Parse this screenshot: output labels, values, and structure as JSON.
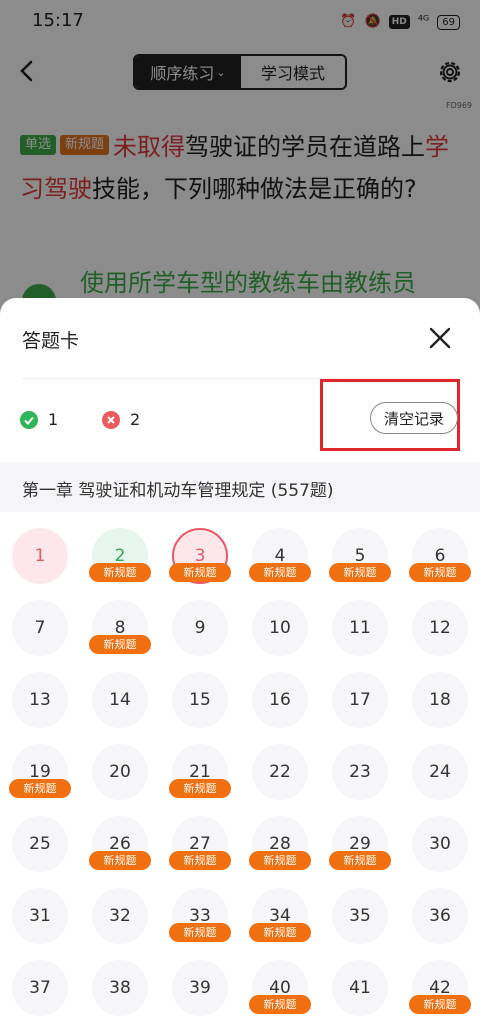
{
  "status_bar": {
    "time": "15:17",
    "net": "⁴ᴳ",
    "hd": "HD",
    "battery": "69"
  },
  "nav": {
    "mode_order": "顺序练习",
    "mode_study": "学习模式"
  },
  "code": "FD969",
  "question": {
    "tag_single": "单选",
    "tag_new": "新规题",
    "parts": [
      {
        "text": "未取得",
        "red": true
      },
      {
        "text": "驾驶证的学员在道路上",
        "red": false
      },
      {
        "text": "学习驾驶",
        "red": true
      },
      {
        "text": "技能，下列哪种做法是正确的?",
        "red": false
      }
    ],
    "option_a": "使用所学车型的教练车由教练员"
  },
  "sheet": {
    "title": "答题卡",
    "correct_count": "1",
    "wrong_count": "2",
    "clear_label": "清空记录",
    "chapter": "第一章  驾驶证和机动车管理规定 (557题)"
  },
  "badge_label": "新规题",
  "colors": {
    "accent_orange": "#f06f10",
    "correct_green": "#2fb55a",
    "wrong_red": "#ee5a5a",
    "highlight": "#e0262c"
  },
  "cells": [
    {
      "n": "1",
      "state": "wrong",
      "new": false
    },
    {
      "n": "2",
      "state": "right",
      "new": true
    },
    {
      "n": "3",
      "state": "current",
      "new": true
    },
    {
      "n": "4",
      "state": "none",
      "new": true
    },
    {
      "n": "5",
      "state": "none",
      "new": true
    },
    {
      "n": "6",
      "state": "none",
      "new": true
    },
    {
      "n": "7",
      "state": "none",
      "new": false
    },
    {
      "n": "8",
      "state": "none",
      "new": true
    },
    {
      "n": "9",
      "state": "none",
      "new": false
    },
    {
      "n": "10",
      "state": "none",
      "new": false
    },
    {
      "n": "11",
      "state": "none",
      "new": false
    },
    {
      "n": "12",
      "state": "none",
      "new": false
    },
    {
      "n": "13",
      "state": "none",
      "new": false
    },
    {
      "n": "14",
      "state": "none",
      "new": false
    },
    {
      "n": "15",
      "state": "none",
      "new": false
    },
    {
      "n": "16",
      "state": "none",
      "new": false
    },
    {
      "n": "17",
      "state": "none",
      "new": false
    },
    {
      "n": "18",
      "state": "none",
      "new": false
    },
    {
      "n": "19",
      "state": "none",
      "new": true
    },
    {
      "n": "20",
      "state": "none",
      "new": false
    },
    {
      "n": "21",
      "state": "none",
      "new": true
    },
    {
      "n": "22",
      "state": "none",
      "new": false
    },
    {
      "n": "23",
      "state": "none",
      "new": false
    },
    {
      "n": "24",
      "state": "none",
      "new": false
    },
    {
      "n": "25",
      "state": "none",
      "new": false
    },
    {
      "n": "26",
      "state": "none",
      "new": true
    },
    {
      "n": "27",
      "state": "none",
      "new": true
    },
    {
      "n": "28",
      "state": "none",
      "new": true
    },
    {
      "n": "29",
      "state": "none",
      "new": true
    },
    {
      "n": "30",
      "state": "none",
      "new": false
    },
    {
      "n": "31",
      "state": "none",
      "new": false
    },
    {
      "n": "32",
      "state": "none",
      "new": false
    },
    {
      "n": "33",
      "state": "none",
      "new": true
    },
    {
      "n": "34",
      "state": "none",
      "new": true
    },
    {
      "n": "35",
      "state": "none",
      "new": false
    },
    {
      "n": "36",
      "state": "none",
      "new": false
    },
    {
      "n": "37",
      "state": "none",
      "new": false
    },
    {
      "n": "38",
      "state": "none",
      "new": false
    },
    {
      "n": "39",
      "state": "none",
      "new": false
    },
    {
      "n": "40",
      "state": "none",
      "new": true
    },
    {
      "n": "41",
      "state": "none",
      "new": false
    },
    {
      "n": "42",
      "state": "none",
      "new": true
    }
  ]
}
